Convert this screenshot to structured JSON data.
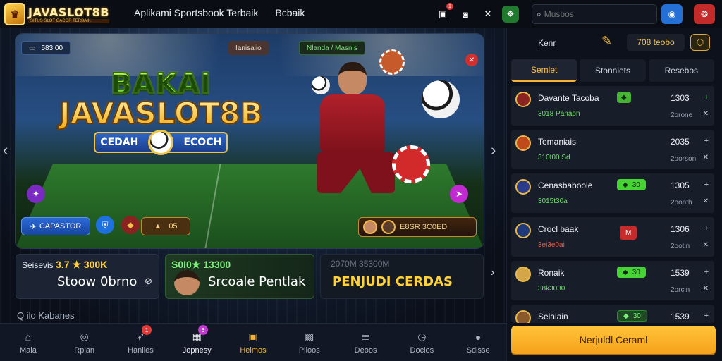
{
  "header": {
    "logo_text": "JAVASLOT8B",
    "logo_tagline": "SITUS SLOT GACOR TERBAIK",
    "nav": [
      "Aplikami Sportsbook Terbaik",
      "Bcbaik"
    ],
    "search_placeholder": "Musbos",
    "notification_count": "1",
    "icons": [
      "wallet-icon",
      "screen-icon",
      "shuffle-icon",
      "green-action-icon",
      "search-icon",
      "user-circle-icon",
      "gift-icon"
    ]
  },
  "banner": {
    "balance_chip": "583 00",
    "tab_center": "Ianisaiio",
    "tab_green": "Nlanda / Masnis",
    "title_line1": "BAKAI",
    "title_line2": "JAVASLOT8B",
    "badge_left": "CEDAH",
    "badge_right": "ECOCH",
    "btn_primary": "CAPASTOR",
    "btn_counter": "05",
    "promo_text": "E8SR 3C0ED"
  },
  "promo_cards": [
    {
      "top_label": "Seisevis",
      "top_value": "3.7 ★ 300K",
      "main": "Stoow 0brno",
      "accent": "#ffd23a"
    },
    {
      "top_label": "",
      "top_value": "S0I0★ 13300",
      "main": "Srcoale Pentlak",
      "accent": "#6cf07a"
    },
    {
      "top_label": "",
      "top_value": "2070M 35300M",
      "main": "PENJUDI CERDAS",
      "accent": "#ffd23a"
    }
  ],
  "section_label": "Q ilo Kabanes",
  "bottom_nav": [
    {
      "label": "Mala",
      "icon": "home-icon",
      "active": false,
      "badge": ""
    },
    {
      "label": "Rplan",
      "icon": "compass-icon",
      "active": false,
      "badge": ""
    },
    {
      "label": "Hanlies",
      "icon": "rocket-icon",
      "active": false,
      "badge": "1"
    },
    {
      "label": "Jopnesy",
      "icon": "gift-box-icon",
      "active": false,
      "badge": "6"
    },
    {
      "label": "Heimos",
      "icon": "casino-icon",
      "active": true,
      "badge": ""
    },
    {
      "label": "Plioos",
      "icon": "gamepad-icon",
      "active": false,
      "badge": ""
    },
    {
      "label": "Deoos",
      "icon": "document-icon",
      "active": false,
      "badge": ""
    },
    {
      "label": "Docios",
      "icon": "timer-icon",
      "active": false,
      "badge": ""
    },
    {
      "label": "Sdisse",
      "icon": "chat-icon",
      "active": false,
      "badge": ""
    }
  ],
  "right_panel": {
    "title": "Kenr",
    "balance": "708 teobo",
    "tabs": [
      "Semlet",
      "Stonniets",
      "Resebos"
    ],
    "active_tab": 0,
    "rows": [
      {
        "name": "Davante Tacoba",
        "sub": "3018 Panaon",
        "pill": "",
        "pill_color": "#46b334",
        "value": "1303",
        "meta": "2orone",
        "icon1": "+",
        "icon2": "✕"
      },
      {
        "name": "Temaniais",
        "sub": "310t00 Sd",
        "pill": "",
        "pill_color": "",
        "value": "2035",
        "meta": "2oorson",
        "icon1": "+",
        "icon2": "✕"
      },
      {
        "name": "Cenasbaboole",
        "sub": "3015t30a",
        "pill": "30",
        "pill_color": "#46d334",
        "value": "1305",
        "meta": "2oonth",
        "icon1": "+",
        "icon2": "✕"
      },
      {
        "name": "Crocl baak",
        "sub": "3ei3e0ai",
        "pill": "",
        "pill_color": "#c62a2a",
        "value": "1306",
        "meta": "2ootin",
        "icon1": "+",
        "icon2": "✕"
      },
      {
        "name": "Ronaik",
        "sub": "38k3030",
        "pill": "30",
        "pill_color": "#46d334",
        "value": "1539",
        "meta": "2orcin",
        "icon1": "+",
        "icon2": "✕"
      },
      {
        "name": "Selalain",
        "sub": "",
        "pill": "30",
        "pill_color": "#1d4a22",
        "value": "1539",
        "meta": "",
        "icon1": "+",
        "icon2": ""
      }
    ],
    "cta": "Nerjuldl Ceraml"
  }
}
